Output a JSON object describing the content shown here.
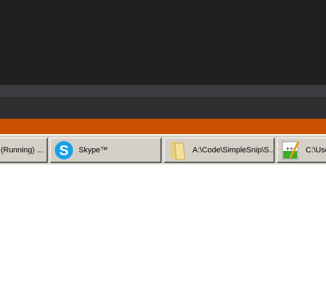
{
  "taskbar": {
    "items": [
      {
        "label": "(Running) ...",
        "icon": "app-icon"
      },
      {
        "label": "Skype™",
        "icon": "skype-icon"
      },
      {
        "label": "A:\\Code\\SimpleSnip\\S...",
        "icon": "folder-icon"
      },
      {
        "label": "C:\\Use",
        "icon": "notepad-plus-plus-icon"
      }
    ]
  },
  "colors": {
    "accent": "#c85000",
    "taskbar": "#d4d0c8"
  }
}
